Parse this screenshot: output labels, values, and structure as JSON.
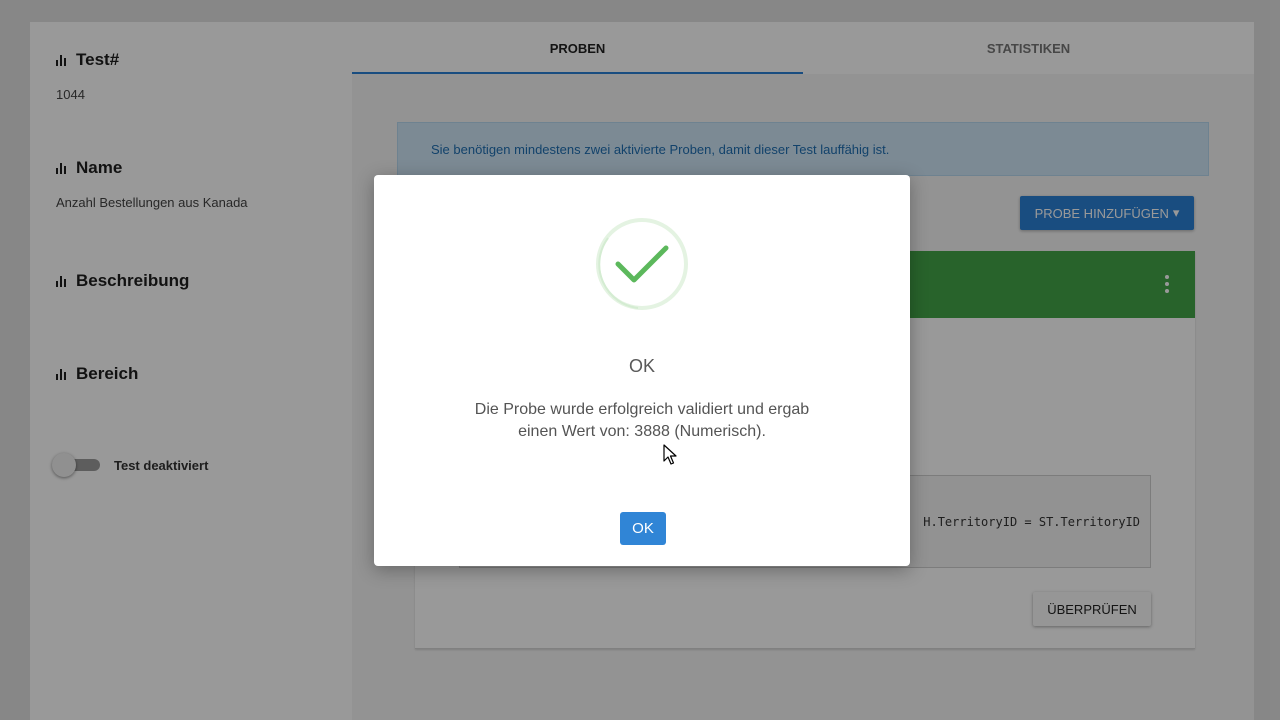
{
  "sidebar": {
    "test_number_label": "Test#",
    "test_number_value": "1044",
    "name_label": "Name",
    "name_value": "Anzahl Bestellungen aus Kanada",
    "description_label": "Beschreibung",
    "description_value": "",
    "scope_label": "Bereich",
    "scope_value": "",
    "toggle_label": "Test deaktiviert",
    "toggle_on": false,
    "label_icon": "bar-chart-icon"
  },
  "tabs": [
    {
      "label": "PROBEN",
      "active": true
    },
    {
      "label": "STATISTIKEN",
      "active": false
    }
  ],
  "main": {
    "info_message": "Sie benötigen mindestens zwei aktivierte Proben, damit dieser Test lauffähig ist.",
    "add_sample_button": "PROBE HINZUFÜGEN",
    "add_sample_caret": "▾",
    "sample_header_color": "#43a648",
    "code_snippet": "H.TerritoryID = ST.TerritoryID",
    "check_button": "ÜBERPRÜFEN"
  },
  "modal": {
    "icon": "success-check-icon",
    "title": "OK",
    "message": "Die Probe wurde erfolgreich validiert und ergab einen Wert von: 3888 (Numerisch).",
    "ok_button": "OK",
    "accent_color": "#3085d6",
    "success_color": "#5cb85c"
  }
}
